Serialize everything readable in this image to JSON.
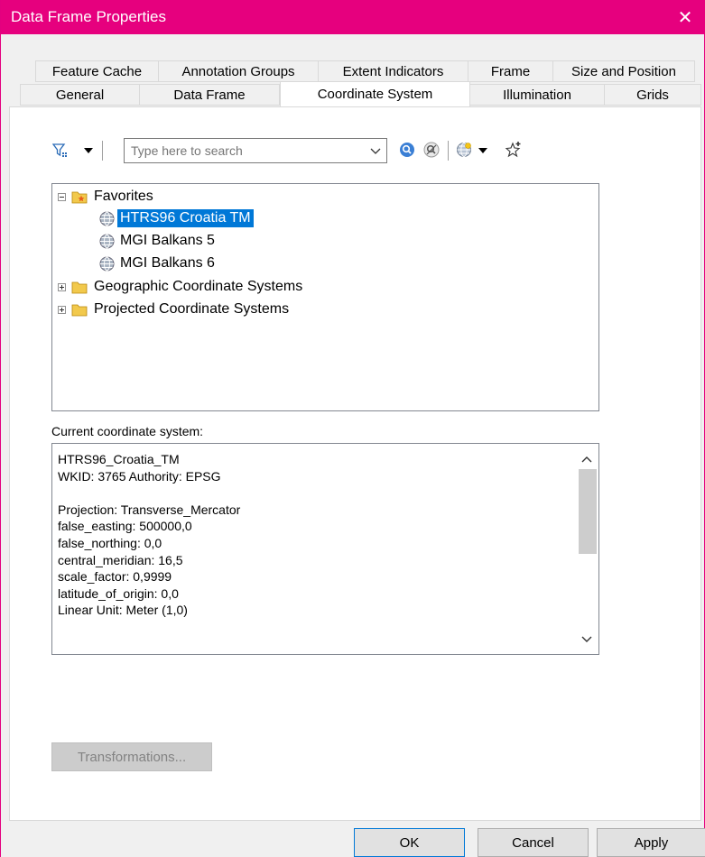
{
  "window": {
    "title": "Data Frame Properties",
    "accent_color": "#e6007e"
  },
  "tabs": {
    "row1": [
      {
        "label": "Feature Cache"
      },
      {
        "label": "Annotation Groups"
      },
      {
        "label": "Extent Indicators"
      },
      {
        "label": "Frame"
      },
      {
        "label": "Size and Position"
      }
    ],
    "row2": [
      {
        "label": "General"
      },
      {
        "label": "Data Frame"
      },
      {
        "label": "Coordinate System",
        "active": true
      },
      {
        "label": "Illumination"
      },
      {
        "label": "Grids"
      }
    ]
  },
  "toolbar": {
    "search_placeholder": "Type here to search",
    "icons": [
      "filter-icon",
      "dropdown-arrow-icon",
      "search-icon",
      "clear-search-icon",
      "globe-icon",
      "dropdown-arrow-icon",
      "add-favorite-icon"
    ]
  },
  "tree": {
    "favorites": {
      "label": "Favorites",
      "children": [
        {
          "label": "HTRS96 Croatia TM",
          "selected": true
        },
        {
          "label": "MGI Balkans 5"
        },
        {
          "label": "MGI Balkans 6"
        }
      ]
    },
    "folders": [
      {
        "label": "Geographic Coordinate Systems"
      },
      {
        "label": "Projected Coordinate Systems"
      }
    ]
  },
  "current": {
    "label": "Current coordinate system:",
    "lines": [
      "HTRS96_Croatia_TM",
      "WKID: 3765 Authority: EPSG",
      "",
      "Projection: Transverse_Mercator",
      "false_easting: 500000,0",
      "false_northing: 0,0",
      "central_meridian: 16,5",
      "scale_factor: 0,9999",
      "latitude_of_origin: 0,0",
      "Linear Unit: Meter (1,0)"
    ]
  },
  "buttons": {
    "transformations": "Transformations...",
    "ok": "OK",
    "cancel": "Cancel",
    "apply": "Apply"
  }
}
